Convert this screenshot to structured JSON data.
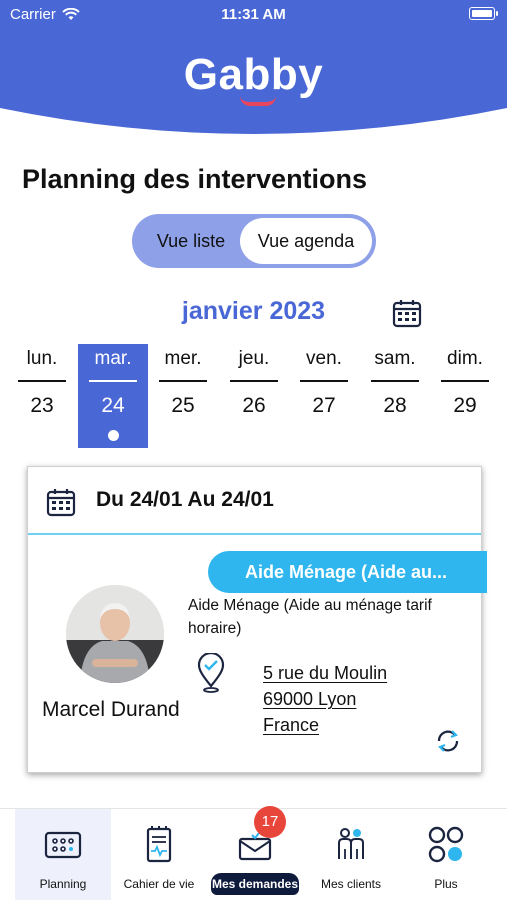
{
  "status_bar": {
    "carrier": "Carrier",
    "time": "11:31 AM"
  },
  "app": {
    "logo_text": "Gabby"
  },
  "page": {
    "title": "Planning des interventions"
  },
  "view_toggle": {
    "list_label": "Vue liste",
    "agenda_label": "Vue agenda",
    "selected": "Vue agenda"
  },
  "calendar": {
    "month_label": "janvier 2023",
    "days": [
      {
        "name": "lun.",
        "number": "23"
      },
      {
        "name": "mar.",
        "number": "24"
      },
      {
        "name": "mer.",
        "number": "25"
      },
      {
        "name": "jeu.",
        "number": "26"
      },
      {
        "name": "ven.",
        "number": "27"
      },
      {
        "name": "sam.",
        "number": "28"
      },
      {
        "name": "dim.",
        "number": "29"
      }
    ],
    "selected_day": "24"
  },
  "intervention": {
    "date_range": "Du 24/01 Au 24/01",
    "service_badge": "Aide Ménage (Aide au...",
    "service_description": "Aide Ménage (Aide au ménage tarif horaire)",
    "client_name": "Marcel Durand",
    "address": {
      "street": "5 rue du Moulin",
      "city": "69000 Lyon",
      "country": "France"
    }
  },
  "tabbar": {
    "items": [
      {
        "label": "Planning",
        "icon": "planning-icon"
      },
      {
        "label": "Cahier de vie",
        "icon": "notebook-icon"
      },
      {
        "label": "Mes demandes",
        "icon": "mail-icon",
        "badge": "17"
      },
      {
        "label": "Mes clients",
        "icon": "clients-icon"
      },
      {
        "label": "Plus",
        "icon": "more-icon"
      }
    ]
  },
  "colors": {
    "primary": "#4a67d6",
    "accent": "#2fb6ee",
    "badge": "#e8463a",
    "navy": "#0e1b3d"
  }
}
